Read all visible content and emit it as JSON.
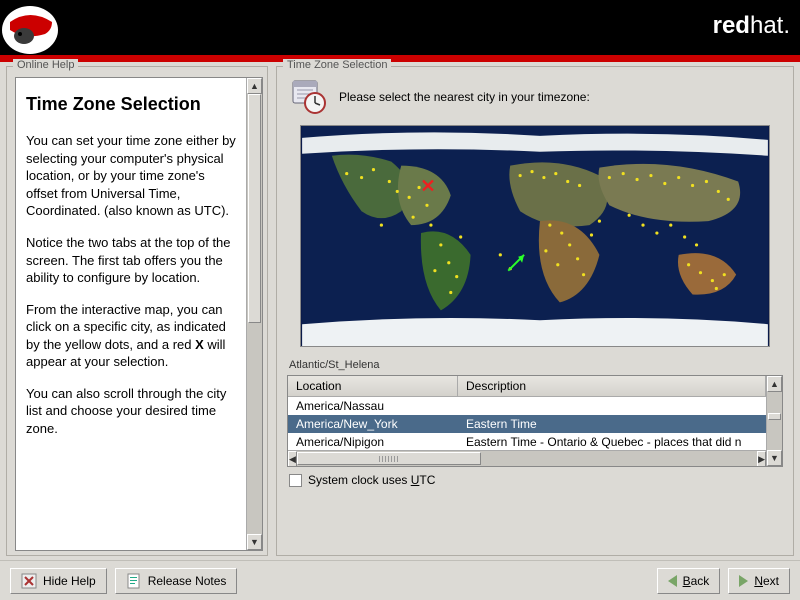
{
  "header": {
    "brand_bold": "red",
    "brand_light": "hat."
  },
  "help": {
    "panel_label": "Online Help",
    "title": "Time Zone Selection",
    "p1": "You can set your time zone either by selecting your computer's physical location, or by your time zone's offset from Universal Time, Coordinated. (also known as UTC).",
    "p2": "Notice the two tabs at the top of the screen. The first tab offers you the ability to configure by location.",
    "p3": "From the interactive map, you can click on a specific city, as indicated by the yellow dots, and a red X will appear at your selection.",
    "p4": "You can also scroll through the city list and choose your desired time zone."
  },
  "tz": {
    "panel_label": "Time Zone Selection",
    "prompt": "Please select the nearest city in your timezone:",
    "hover_city": "Atlantic/St_Helena",
    "col_location": "Location",
    "col_description": "Description",
    "rows": [
      {
        "loc": "America/Nassau",
        "desc": ""
      },
      {
        "loc": "America/New_York",
        "desc": "Eastern Time"
      },
      {
        "loc": "America/Nipigon",
        "desc": "Eastern Time - Ontario & Quebec - places that did n"
      }
    ],
    "selected_index": 1,
    "utc_label_pre": "System clock uses ",
    "utc_label_u": "U",
    "utc_label_post": "TC"
  },
  "footer": {
    "hide_help_icon": "✕",
    "hide_help": "Hide Help",
    "release_notes": "Release Notes",
    "back_u": "B",
    "back_post": "ack",
    "next_u": "N",
    "next_post": "ext"
  }
}
